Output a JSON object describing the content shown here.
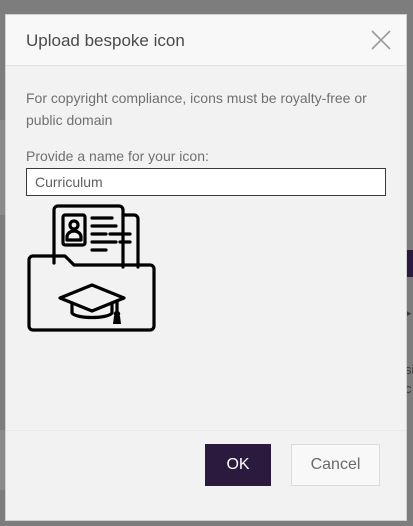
{
  "dialog": {
    "title": "Upload bespoke icon",
    "notice": "For copyright compliance, icons must be royalty-free or public domain",
    "name_label": "Provide a name for your icon:",
    "name_value": "Curriculum",
    "preview_icon": "curriculum-folder-graduation-cap-icon",
    "ok_label": "OK",
    "cancel_label": "Cancel"
  },
  "background": {
    "text_1": "si",
    "text_2": "c"
  },
  "colors": {
    "primary": "#2b1a3e",
    "overlay": "#7d7d7d",
    "dialog_bg": "#f2f2f2"
  }
}
